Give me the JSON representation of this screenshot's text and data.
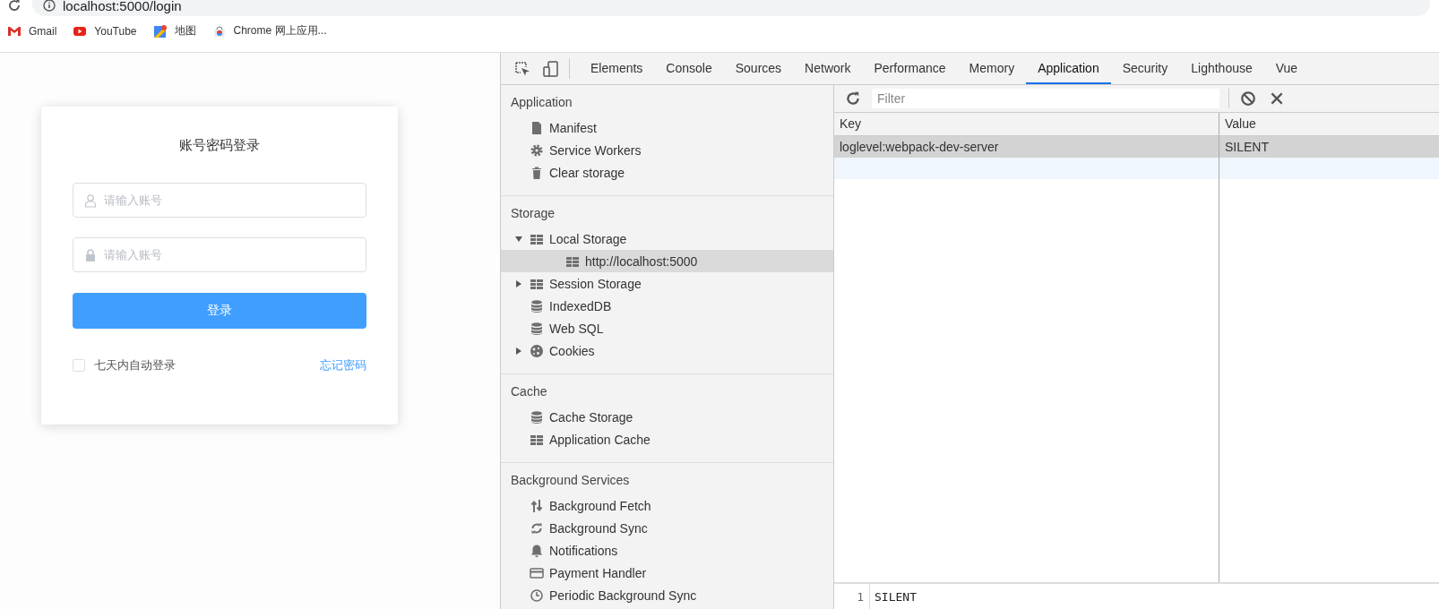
{
  "browser": {
    "address": "localhost:5000/login",
    "bookmarks": [
      {
        "label": "Gmail",
        "kind": "mail"
      },
      {
        "label": "YouTube",
        "kind": "video"
      },
      {
        "label": "地图",
        "kind": "map"
      },
      {
        "label": "Chrome 网上应用...",
        "kind": "store"
      }
    ]
  },
  "login": {
    "title": "账号密码登录",
    "fields": [
      {
        "kind": "user",
        "placeholder": "请输入账号"
      },
      {
        "kind": "lock",
        "placeholder": "请输入账号"
      }
    ],
    "button": "登录",
    "remember": {
      "label": "七天内自动登录",
      "checked": false
    },
    "forgot": "忘记密码"
  },
  "devtools": {
    "tabs": [
      {
        "label": "Elements",
        "selected": false
      },
      {
        "label": "Console",
        "selected": false
      },
      {
        "label": "Sources",
        "selected": false
      },
      {
        "label": "Network",
        "selected": false
      },
      {
        "label": "Performance",
        "selected": false
      },
      {
        "label": "Memory",
        "selected": false
      },
      {
        "label": "Application",
        "selected": true
      },
      {
        "label": "Security",
        "selected": false
      },
      {
        "label": "Lighthouse",
        "selected": false
      },
      {
        "label": "Vue",
        "selected": false
      }
    ],
    "sidebar": [
      {
        "title": "Application",
        "items": [
          {
            "label": "Manifest",
            "kind": "file",
            "selected": false
          },
          {
            "label": "Service Workers",
            "kind": "gear",
            "selected": false
          },
          {
            "label": "Clear storage",
            "kind": "trash",
            "selected": false
          }
        ]
      },
      {
        "title": "Storage",
        "items": [
          {
            "label": "Local Storage",
            "kind": "grid",
            "selected": false,
            "expanded": true,
            "children": [
              {
                "label": "http://localhost:5000",
                "kind": "grid",
                "selected": true
              }
            ]
          },
          {
            "label": "Session Storage",
            "kind": "grid",
            "selected": false,
            "expanded": false
          },
          {
            "label": "IndexedDB",
            "kind": "database",
            "selected": false
          },
          {
            "label": "Web SQL",
            "kind": "database",
            "selected": false
          },
          {
            "label": "Cookies",
            "kind": "cookie",
            "selected": false,
            "expanded": false
          }
        ]
      },
      {
        "title": "Cache",
        "items": [
          {
            "label": "Cache Storage",
            "kind": "database",
            "selected": false
          },
          {
            "label": "Application Cache",
            "kind": "grid",
            "selected": false
          }
        ]
      },
      {
        "title": "Background Services",
        "items": [
          {
            "label": "Background Fetch",
            "kind": "updown",
            "selected": false
          },
          {
            "label": "Background Sync",
            "kind": "sync",
            "selected": false
          },
          {
            "label": "Notifications",
            "kind": "bell",
            "selected": false
          },
          {
            "label": "Payment Handler",
            "kind": "card",
            "selected": false
          },
          {
            "label": "Periodic Background Sync",
            "kind": "clock",
            "selected": false
          }
        ]
      }
    ],
    "storage": {
      "filter_placeholder": "Filter",
      "columns": [
        "Key",
        "Value"
      ],
      "rows": [
        {
          "key": "loglevel:webpack-dev-server",
          "value": "SILENT",
          "selected": true
        }
      ],
      "preview": {
        "line": "1",
        "text": "SILENT"
      }
    }
  }
}
